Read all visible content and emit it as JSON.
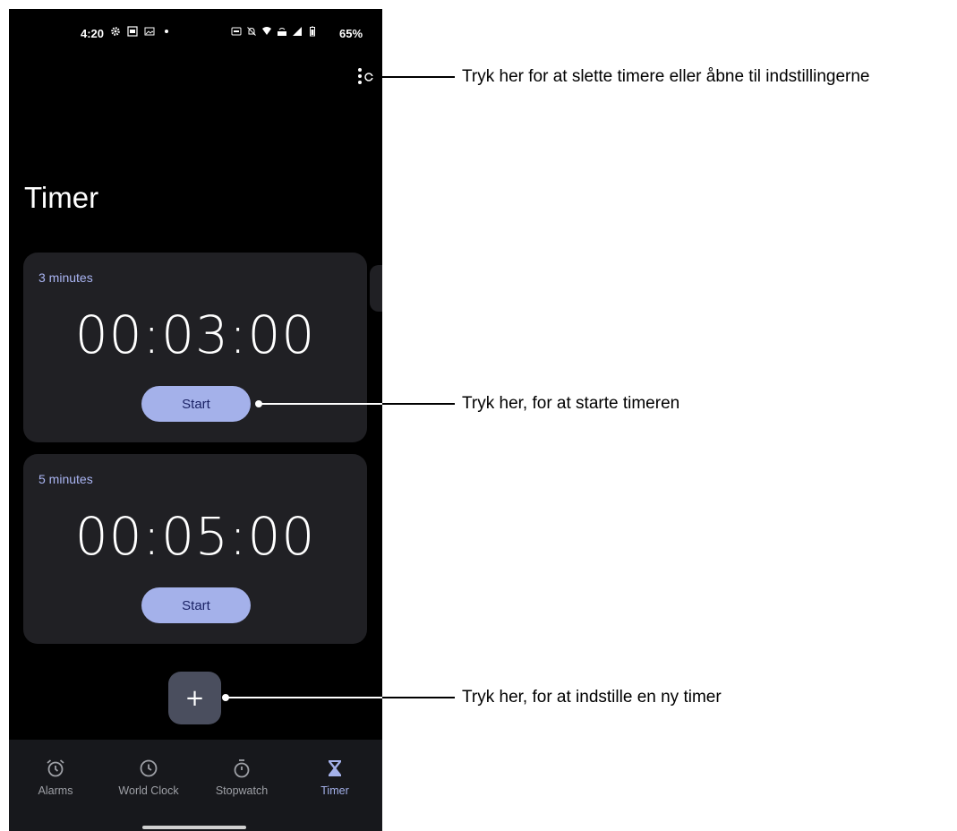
{
  "status_bar": {
    "time": "4:20",
    "left_icons": [
      "gear-icon",
      "image-icon",
      "photo-icon",
      "dot-icon"
    ],
    "right_icons": [
      "auto-icon",
      "mute-icon",
      "wifi-icon",
      "volte-icon",
      "signal-icon",
      "battery-icon"
    ],
    "battery": "65%"
  },
  "header": {
    "title": "Timer"
  },
  "timers": [
    {
      "label": "3 minutes",
      "time": "00:03:00",
      "button": "Start"
    },
    {
      "label": "5 minutes",
      "time": "00:05:00",
      "button": "Start"
    }
  ],
  "fab": {
    "label": "+"
  },
  "nav": {
    "items": [
      {
        "label": "Alarms",
        "icon": "alarm-icon"
      },
      {
        "label": "World Clock",
        "icon": "clock-icon"
      },
      {
        "label": "Stopwatch",
        "icon": "stopwatch-icon"
      },
      {
        "label": "Timer",
        "icon": "hourglass-icon",
        "active": true
      }
    ]
  },
  "annotations": [
    "Tryk her for at slette timere eller åbne til indstillingerne",
    "Tryk her, for at starte timeren",
    "Tryk her, for at indstille en ny timer"
  ],
  "colors": {
    "screen_bg": "#000000",
    "card_bg": "#202024",
    "accent": "#a4b1ea",
    "label_blue": "#aab5f3",
    "fab_bg": "#4a4e5e",
    "nav_bg": "#17181c"
  }
}
